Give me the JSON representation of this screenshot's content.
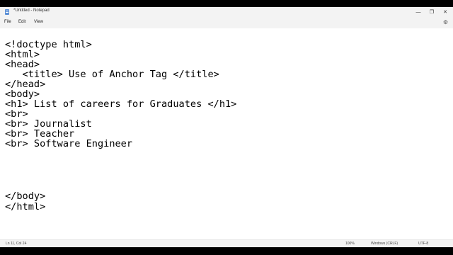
{
  "window": {
    "title": "*Untitled - Notepad",
    "app_icon": "notepad-icon",
    "controls": [
      "minimize-icon",
      "maximize-icon",
      "close-icon"
    ]
  },
  "menu": {
    "file": "File",
    "edit": "Edit",
    "view": "View",
    "settings_icon": "gear-icon"
  },
  "editor": {
    "lines": [
      "<!doctype html>",
      "<html>",
      "<head>",
      "   <title> Use of Anchor Tag </title>",
      "</head>",
      "<body>",
      "<h1> List of careers for Graduates </h1>",
      "<br>",
      "<br> Journalist",
      "<br> Teacher",
      "<br> Software Engineer",
      "",
      "",
      "",
      "",
      "</body>",
      "</html>"
    ]
  },
  "status": {
    "position": "Ln 11, Col 24",
    "zoom": "100%",
    "line_ending": "Windows (CRLF)",
    "encoding": "UTF-8"
  }
}
